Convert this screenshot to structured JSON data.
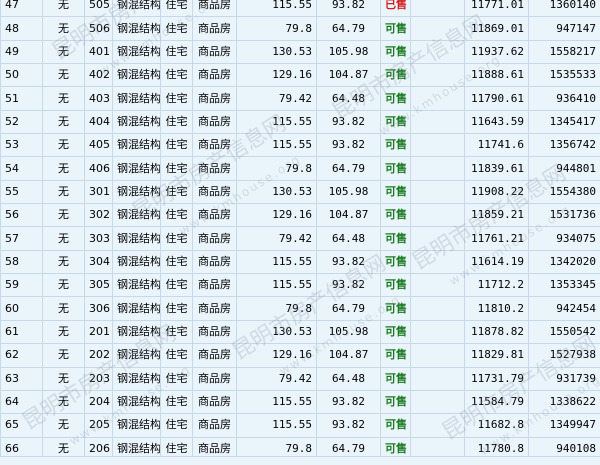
{
  "watermark": {
    "text": "昆明市房产信息网",
    "url": "www.kmhouse.org"
  },
  "rows": [
    {
      "seq": "47",
      "mark": "无",
      "room": "505",
      "structure": "钢混结构",
      "use": "住宅",
      "type": "商品房",
      "area": "115.55",
      "inner": "93.82",
      "status": "已售",
      "price": "11771.01",
      "total": "1360140"
    },
    {
      "seq": "48",
      "mark": "无",
      "room": "506",
      "structure": "钢混结构",
      "use": "住宅",
      "type": "商品房",
      "area": "79.8",
      "inner": "64.79",
      "status": "可售",
      "price": "11869.01",
      "total": "947147"
    },
    {
      "seq": "49",
      "mark": "无",
      "room": "401",
      "structure": "钢混结构",
      "use": "住宅",
      "type": "商品房",
      "area": "130.53",
      "inner": "105.98",
      "status": "可售",
      "price": "11937.62",
      "total": "1558217"
    },
    {
      "seq": "50",
      "mark": "无",
      "room": "402",
      "structure": "钢混结构",
      "use": "住宅",
      "type": "商品房",
      "area": "129.16",
      "inner": "104.87",
      "status": "可售",
      "price": "11888.61",
      "total": "1535533"
    },
    {
      "seq": "51",
      "mark": "无",
      "room": "403",
      "structure": "钢混结构",
      "use": "住宅",
      "type": "商品房",
      "area": "79.42",
      "inner": "64.48",
      "status": "可售",
      "price": "11790.61",
      "total": "936410"
    },
    {
      "seq": "52",
      "mark": "无",
      "room": "404",
      "structure": "钢混结构",
      "use": "住宅",
      "type": "商品房",
      "area": "115.55",
      "inner": "93.82",
      "status": "可售",
      "price": "11643.59",
      "total": "1345417"
    },
    {
      "seq": "53",
      "mark": "无",
      "room": "405",
      "structure": "钢混结构",
      "use": "住宅",
      "type": "商品房",
      "area": "115.55",
      "inner": "93.82",
      "status": "可售",
      "price": "11741.6",
      "total": "1356742"
    },
    {
      "seq": "54",
      "mark": "无",
      "room": "406",
      "structure": "钢混结构",
      "use": "住宅",
      "type": "商品房",
      "area": "79.8",
      "inner": "64.79",
      "status": "可售",
      "price": "11839.61",
      "total": "944801"
    },
    {
      "seq": "55",
      "mark": "无",
      "room": "301",
      "structure": "钢混结构",
      "use": "住宅",
      "type": "商品房",
      "area": "130.53",
      "inner": "105.98",
      "status": "可售",
      "price": "11908.22",
      "total": "1554380"
    },
    {
      "seq": "56",
      "mark": "无",
      "room": "302",
      "structure": "钢混结构",
      "use": "住宅",
      "type": "商品房",
      "area": "129.16",
      "inner": "104.87",
      "status": "可售",
      "price": "11859.21",
      "total": "1531736"
    },
    {
      "seq": "57",
      "mark": "无",
      "room": "303",
      "structure": "钢混结构",
      "use": "住宅",
      "type": "商品房",
      "area": "79.42",
      "inner": "64.48",
      "status": "可售",
      "price": "11761.21",
      "total": "934075"
    },
    {
      "seq": "58",
      "mark": "无",
      "room": "304",
      "structure": "钢混结构",
      "use": "住宅",
      "type": "商品房",
      "area": "115.55",
      "inner": "93.82",
      "status": "可售",
      "price": "11614.19",
      "total": "1342020"
    },
    {
      "seq": "59",
      "mark": "无",
      "room": "305",
      "structure": "钢混结构",
      "use": "住宅",
      "type": "商品房",
      "area": "115.55",
      "inner": "93.82",
      "status": "可售",
      "price": "11712.2",
      "total": "1353345"
    },
    {
      "seq": "60",
      "mark": "无",
      "room": "306",
      "structure": "钢混结构",
      "use": "住宅",
      "type": "商品房",
      "area": "79.8",
      "inner": "64.79",
      "status": "可售",
      "price": "11810.2",
      "total": "942454"
    },
    {
      "seq": "61",
      "mark": "无",
      "room": "201",
      "structure": "钢混结构",
      "use": "住宅",
      "type": "商品房",
      "area": "130.53",
      "inner": "105.98",
      "status": "可售",
      "price": "11878.82",
      "total": "1550542"
    },
    {
      "seq": "62",
      "mark": "无",
      "room": "202",
      "structure": "钢混结构",
      "use": "住宅",
      "type": "商品房",
      "area": "129.16",
      "inner": "104.87",
      "status": "可售",
      "price": "11829.81",
      "total": "1527938"
    },
    {
      "seq": "63",
      "mark": "无",
      "room": "203",
      "structure": "钢混结构",
      "use": "住宅",
      "type": "商品房",
      "area": "79.42",
      "inner": "64.48",
      "status": "可售",
      "price": "11731.79",
      "total": "931739"
    },
    {
      "seq": "64",
      "mark": "无",
      "room": "204",
      "structure": "钢混结构",
      "use": "住宅",
      "type": "商品房",
      "area": "115.55",
      "inner": "93.82",
      "status": "可售",
      "price": "11584.79",
      "total": "1338622"
    },
    {
      "seq": "65",
      "mark": "无",
      "room": "205",
      "structure": "钢混结构",
      "use": "住宅",
      "type": "商品房",
      "area": "115.55",
      "inner": "93.82",
      "status": "可售",
      "price": "11682.8",
      "total": "1349947"
    },
    {
      "seq": "66",
      "mark": "无",
      "room": "206",
      "structure": "钢混结构",
      "use": "住宅",
      "type": "商品房",
      "area": "79.8",
      "inner": "64.79",
      "status": "可售",
      "price": "11780.8",
      "total": "940108"
    }
  ],
  "colors": {
    "cell_bg": "#eaf4fb",
    "border": "#c7d9e8",
    "sold": "#d11f1f",
    "available": "#1a7a20"
  }
}
